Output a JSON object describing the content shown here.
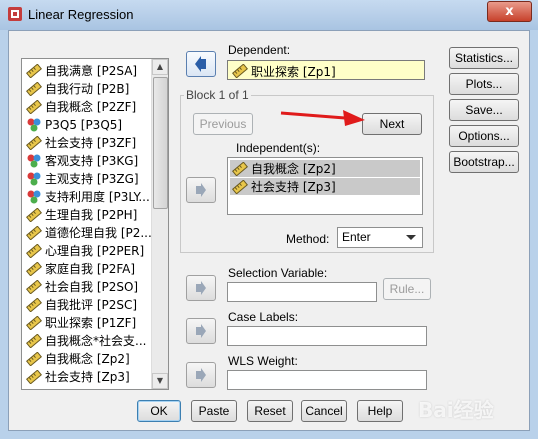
{
  "window": {
    "title": "Linear Regression",
    "close_label": "x"
  },
  "variables": [
    {
      "label": "自我满意 [P2SA]",
      "icon": "ruler-icon"
    },
    {
      "label": "自我行动 [P2B]",
      "icon": "ruler-icon"
    },
    {
      "label": "自我概念 [P2ZF]",
      "icon": "ruler-icon"
    },
    {
      "label": "P3Q5 [P3Q5]",
      "icon": "nominal-icon"
    },
    {
      "label": "社会支持 [P3ZF]",
      "icon": "ruler-icon"
    },
    {
      "label": "客观支持 [P3KG]",
      "icon": "nominal-icon"
    },
    {
      "label": "主观支持 [P3ZG]",
      "icon": "nominal-icon"
    },
    {
      "label": "支持利用度 [P3LY...",
      "icon": "nominal-icon"
    },
    {
      "label": "生理自我 [P2PH]",
      "icon": "ruler-icon"
    },
    {
      "label": "道德伦理自我 [P2...",
      "icon": "ruler-icon"
    },
    {
      "label": "心理自我 [P2PER]",
      "icon": "ruler-icon"
    },
    {
      "label": "家庭自我 [P2FA]",
      "icon": "ruler-icon"
    },
    {
      "label": "社会自我 [P2SO]",
      "icon": "ruler-icon"
    },
    {
      "label": "自我批评 [P2SC]",
      "icon": "ruler-icon"
    },
    {
      "label": "职业探索 [P1ZF]",
      "icon": "ruler-icon"
    },
    {
      "label": "自我概念*社会支...",
      "icon": "ruler-icon"
    },
    {
      "label": "自我概念 [Zp2]",
      "icon": "ruler-icon"
    },
    {
      "label": "社会支持 [Zp3]",
      "icon": "ruler-icon"
    }
  ],
  "dependent": {
    "label": "Dependent:",
    "value": "职业探索 [Zp1]"
  },
  "block": {
    "title": "Block 1 of 1",
    "previous_label": "Previous",
    "next_label": "Next",
    "independents_label": "Independent(s):",
    "independents": [
      "自我概念 [Zp2]",
      "社会支持 [Zp3]"
    ],
    "method_label": "Method:",
    "method_value": "Enter"
  },
  "selection": {
    "label": "Selection Variable:",
    "value": "",
    "rule_label": "Rule..."
  },
  "case_labels": {
    "label": "Case Labels:",
    "value": ""
  },
  "wls": {
    "label": "WLS Weight:",
    "value": ""
  },
  "side_buttons": [
    "Statistics...",
    "Plots...",
    "Save...",
    "Options...",
    "Bootstrap..."
  ],
  "bottom_buttons": [
    "OK",
    "Paste",
    "Reset",
    "Cancel",
    "Help"
  ],
  "watermark": "Bai经验",
  "colors": {
    "accent": "#2a5ea8",
    "annotation_arrow": "#e01b1b",
    "dependent_bg": "#ffffc8",
    "selected_bg": "#c9c9c9"
  }
}
